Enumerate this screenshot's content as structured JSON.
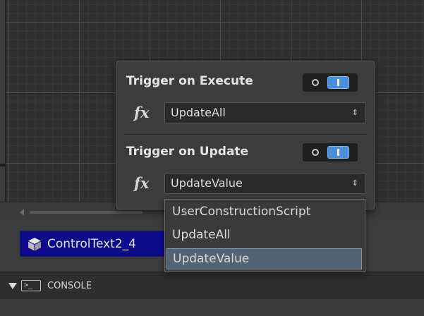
{
  "popup": {
    "execute_section": {
      "title": "Trigger on Execute",
      "fx_symbol": "fx",
      "selected_function": "UpdateAll",
      "toggle_on": true
    },
    "update_section": {
      "title": "Trigger on Update",
      "fx_symbol": "fx",
      "selected_function": "UpdateValue",
      "toggle_on": true
    }
  },
  "dropdown": {
    "options": [
      "UserConstructionScript",
      "UpdateAll",
      "UpdateValue"
    ],
    "selected": "UpdateValue"
  },
  "object_chip": {
    "label": "ControlText2_4"
  },
  "console": {
    "label": "CONSOLE",
    "icon_glyph": ">_"
  },
  "select_arrows_glyph": "⇕",
  "colors": {
    "toggle_accent": "#4a8fd9",
    "chip_background": "#0a0a8a",
    "selected_option": "#536374"
  }
}
